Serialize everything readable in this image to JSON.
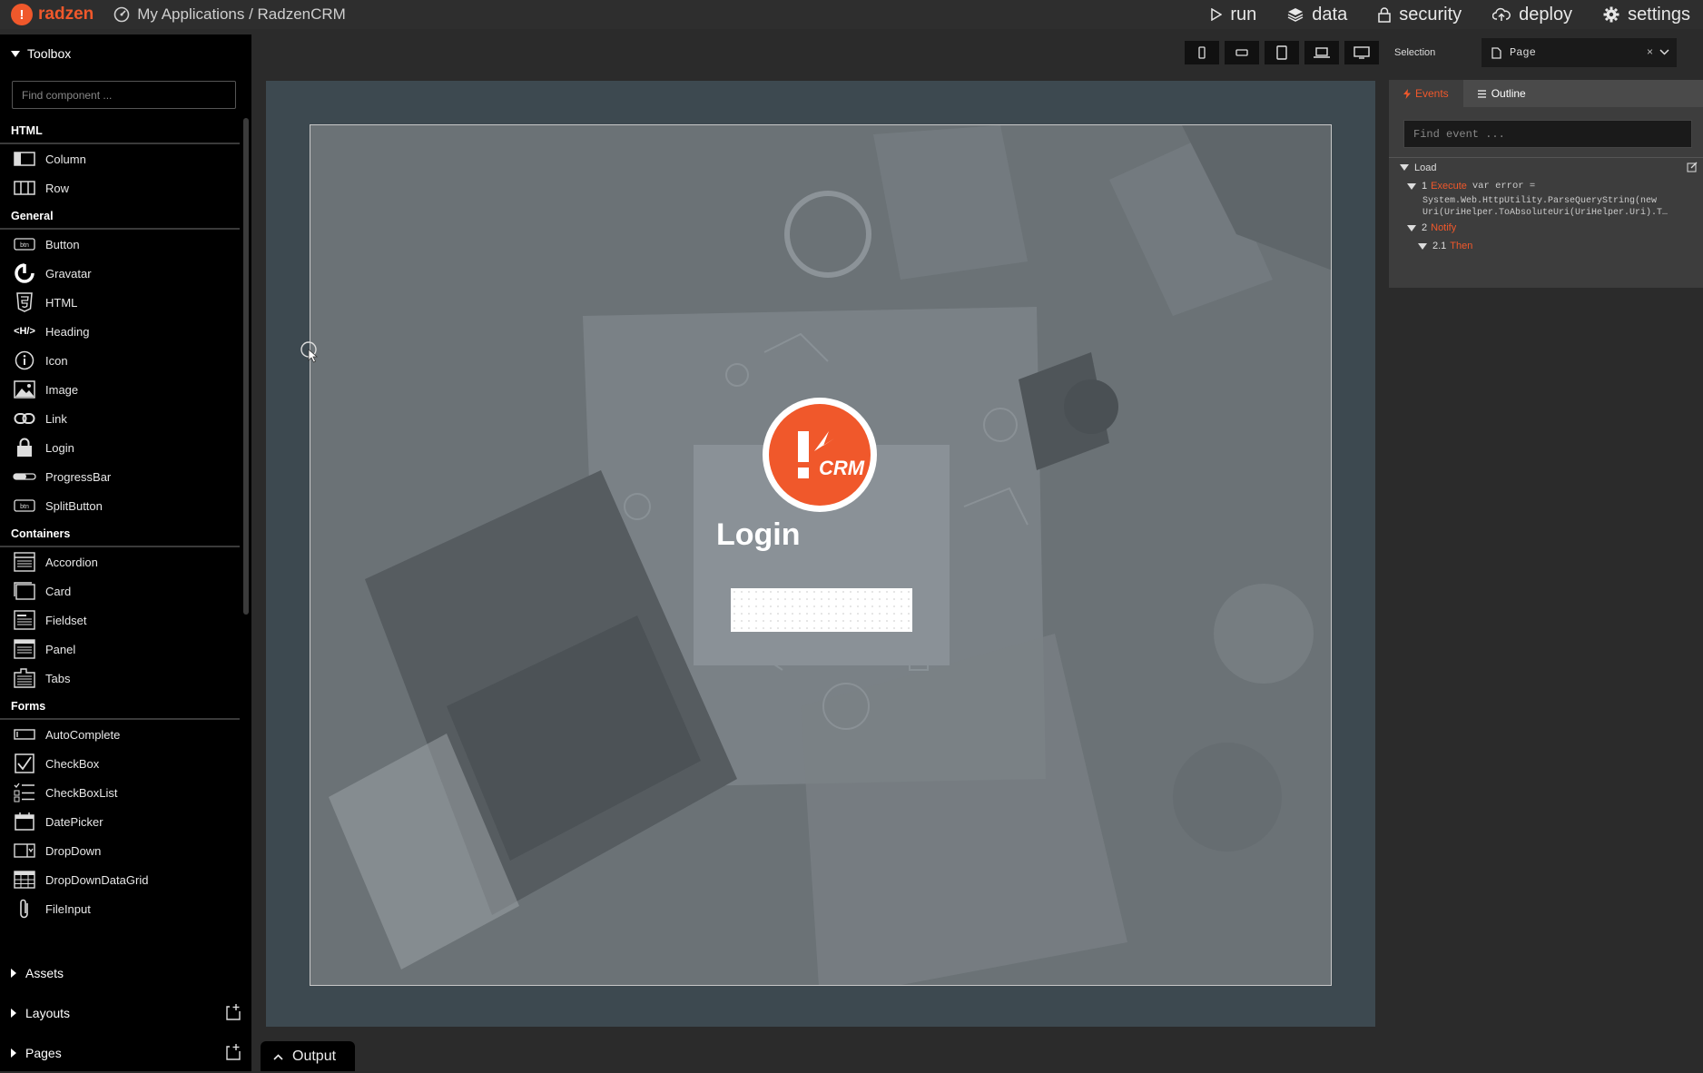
{
  "app": {
    "brand": "radzen",
    "logo_letter": "!",
    "breadcrumb": "My Applications / RadzenCRM"
  },
  "topnav": [
    {
      "label": "run",
      "icon": "play-icon"
    },
    {
      "label": "data",
      "icon": "layers-icon"
    },
    {
      "label": "security",
      "icon": "lock-icon"
    },
    {
      "label": "deploy",
      "icon": "cloud-upload-icon"
    },
    {
      "label": "settings",
      "icon": "gear-icon"
    }
  ],
  "toolbox": {
    "title": "Toolbox",
    "search_placeholder": "Find component ...",
    "categories": {
      "html": "HTML",
      "general": "General",
      "containers": "Containers",
      "forms": "Forms"
    },
    "html_items": [
      "Column",
      "Row"
    ],
    "general_items": [
      "Button",
      "Gravatar",
      "HTML",
      "Heading",
      "Icon",
      "Image",
      "Link",
      "Login",
      "ProgressBar",
      "SplitButton"
    ],
    "container_items": [
      "Accordion",
      "Card",
      "Fieldset",
      "Panel",
      "Tabs"
    ],
    "form_items": [
      "AutoComplete",
      "CheckBox",
      "CheckBoxList",
      "DatePicker",
      "DropDown",
      "DropDownDataGrid",
      "FileInput"
    ],
    "heading_icon_text": "<H/>",
    "btn_icon_text": "btn"
  },
  "bottom_sections": {
    "assets": "Assets",
    "layouts": "Layouts",
    "pages": "Pages"
  },
  "canvas": {
    "login_title": "Login",
    "logo_text": "CRM"
  },
  "output": {
    "label": "Output"
  },
  "properties": {
    "selection_label": "Selection",
    "selection_value": "Page",
    "clear_glyph": "×",
    "tabs": [
      "Events",
      "Outline"
    ],
    "event_search_placeholder": "Find event ...",
    "event_name": "Load",
    "actions": [
      {
        "num": "1",
        "type": "Execute",
        "code": "var error ="
      },
      {
        "num": "2",
        "type": "Notify"
      },
      {
        "num": "2.1",
        "type": "Then"
      }
    ],
    "code_lines": [
      "System.Web.HttpUtility.ParseQueryString(new",
      "Uri(UriHelper.ToAbsoluteUri(UriHelper.Uri).T…"
    ]
  },
  "colors": {
    "accent": "#f0582b",
    "canvas_frame": "#3d4950",
    "panel": "#3d3d3d"
  }
}
